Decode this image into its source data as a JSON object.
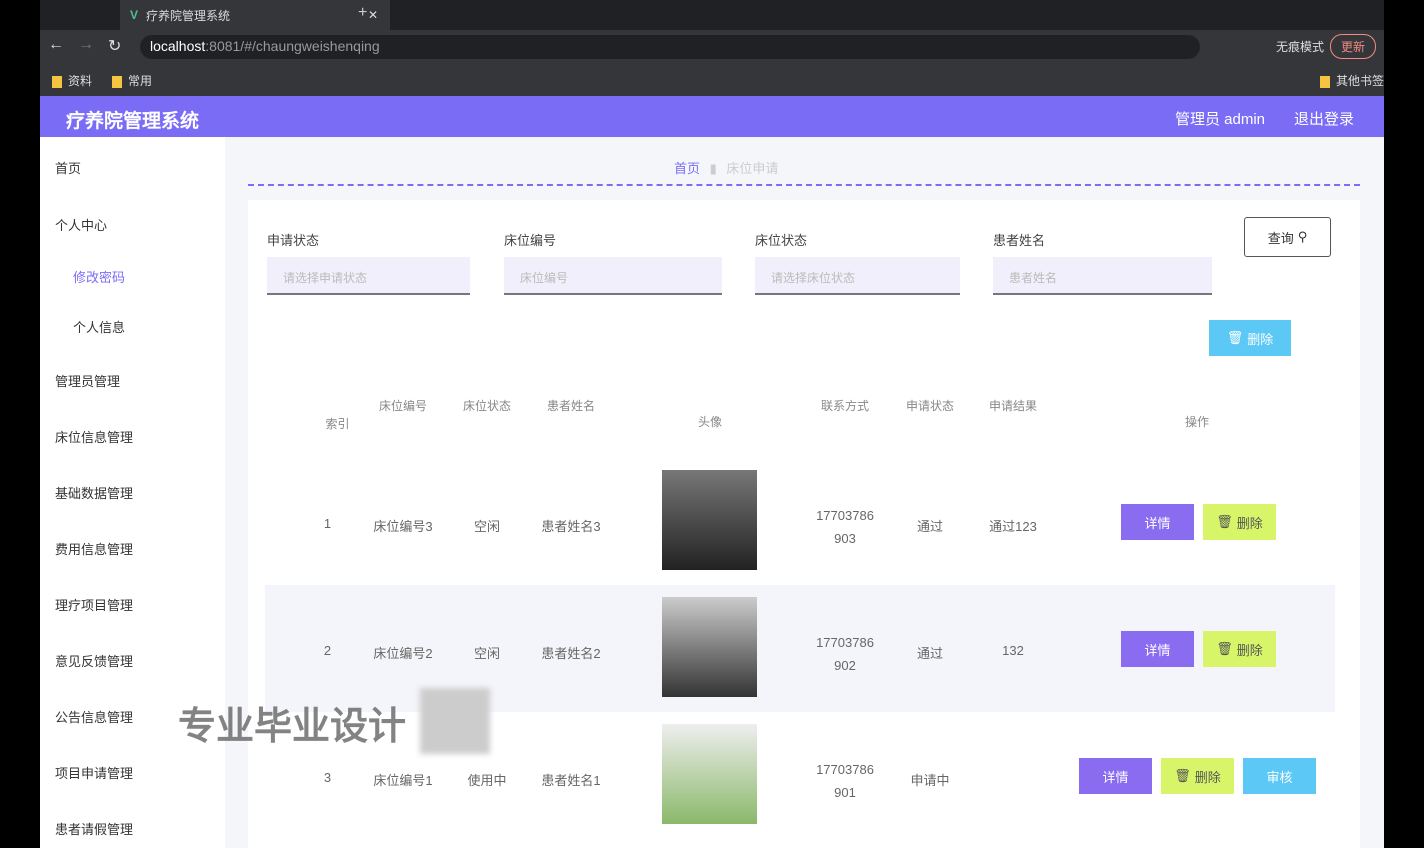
{
  "browser": {
    "tab_title": "疗养院管理系统",
    "url_host": "localhost",
    "url_rest": ":8081/#/chaungweishenqing",
    "bookmarks": [
      "资料",
      "常用"
    ],
    "other_bookmarks": "其他书签",
    "incognito": "无痕模式",
    "update": "更新"
  },
  "header": {
    "title": "疗养院管理系统",
    "user": "管理员 admin",
    "logout": "退出登录"
  },
  "sidebar": {
    "items": [
      "首页",
      "个人中心",
      "修改密码",
      "个人信息",
      "管理员管理",
      "床位信息管理",
      "基础数据管理",
      "费用信息管理",
      "理疗项目管理",
      "意见反馈管理",
      "公告信息管理",
      "项目申请管理",
      "患者请假管理"
    ]
  },
  "breadcrumb": {
    "home": "首页",
    "current": "床位申请"
  },
  "search": {
    "fields": [
      {
        "label": "申请状态",
        "placeholder": "请选择申请状态"
      },
      {
        "label": "床位编号",
        "placeholder": "床位编号"
      },
      {
        "label": "床位状态",
        "placeholder": "请选择床位状态"
      },
      {
        "label": "患者姓名",
        "placeholder": "患者姓名"
      }
    ],
    "query": "查询",
    "delete": "删除"
  },
  "table": {
    "headers": [
      "索引",
      "床位编号",
      "床位状态",
      "患者姓名",
      "头像",
      "联系方式",
      "申请状态",
      "申请结果",
      "操作"
    ],
    "rows": [
      {
        "index": "1",
        "bed": "床位编号3",
        "bed_status": "空闲",
        "name": "患者姓名3",
        "phone1": "17703786",
        "phone2": "903",
        "apply_status": "通过",
        "result": "通过123"
      },
      {
        "index": "2",
        "bed": "床位编号2",
        "bed_status": "空闲",
        "name": "患者姓名2",
        "phone1": "17703786",
        "phone2": "902",
        "apply_status": "通过",
        "result": "132"
      },
      {
        "index": "3",
        "bed": "床位编号1",
        "bed_status": "使用中",
        "name": "患者姓名1",
        "phone1": "17703786",
        "phone2": "901",
        "apply_status": "申请中",
        "result": ""
      }
    ],
    "actions": {
      "detail": "详情",
      "delete": "删除",
      "review": "审核"
    }
  },
  "watermark": "专业毕业设计"
}
